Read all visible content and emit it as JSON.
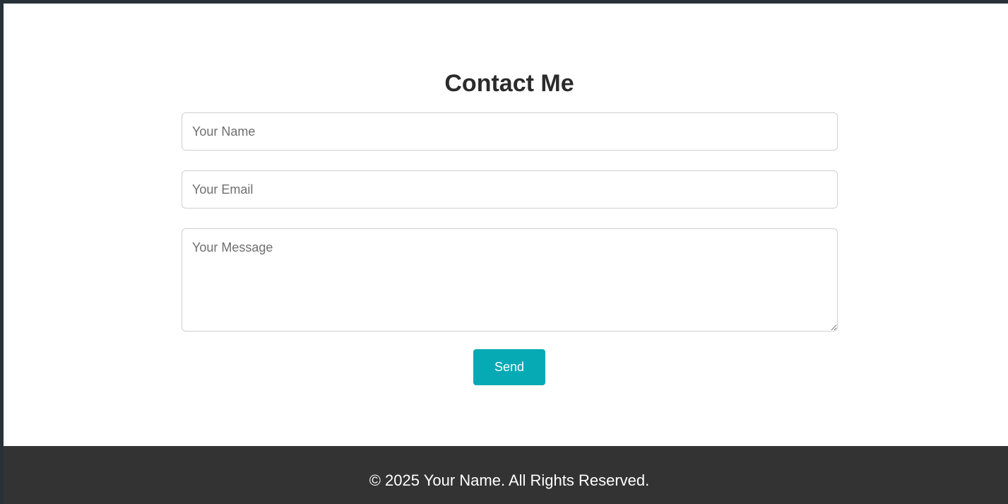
{
  "contact": {
    "title": "Contact Me",
    "name_placeholder": "Your Name",
    "email_placeholder": "Your Email",
    "message_placeholder": "Your Message",
    "send_label": "Send"
  },
  "footer": {
    "text": "© 2025 Your Name. All Rights Reserved."
  },
  "colors": {
    "frame": "#263238",
    "button": "#05aab5",
    "footer_bg": "#333333"
  }
}
